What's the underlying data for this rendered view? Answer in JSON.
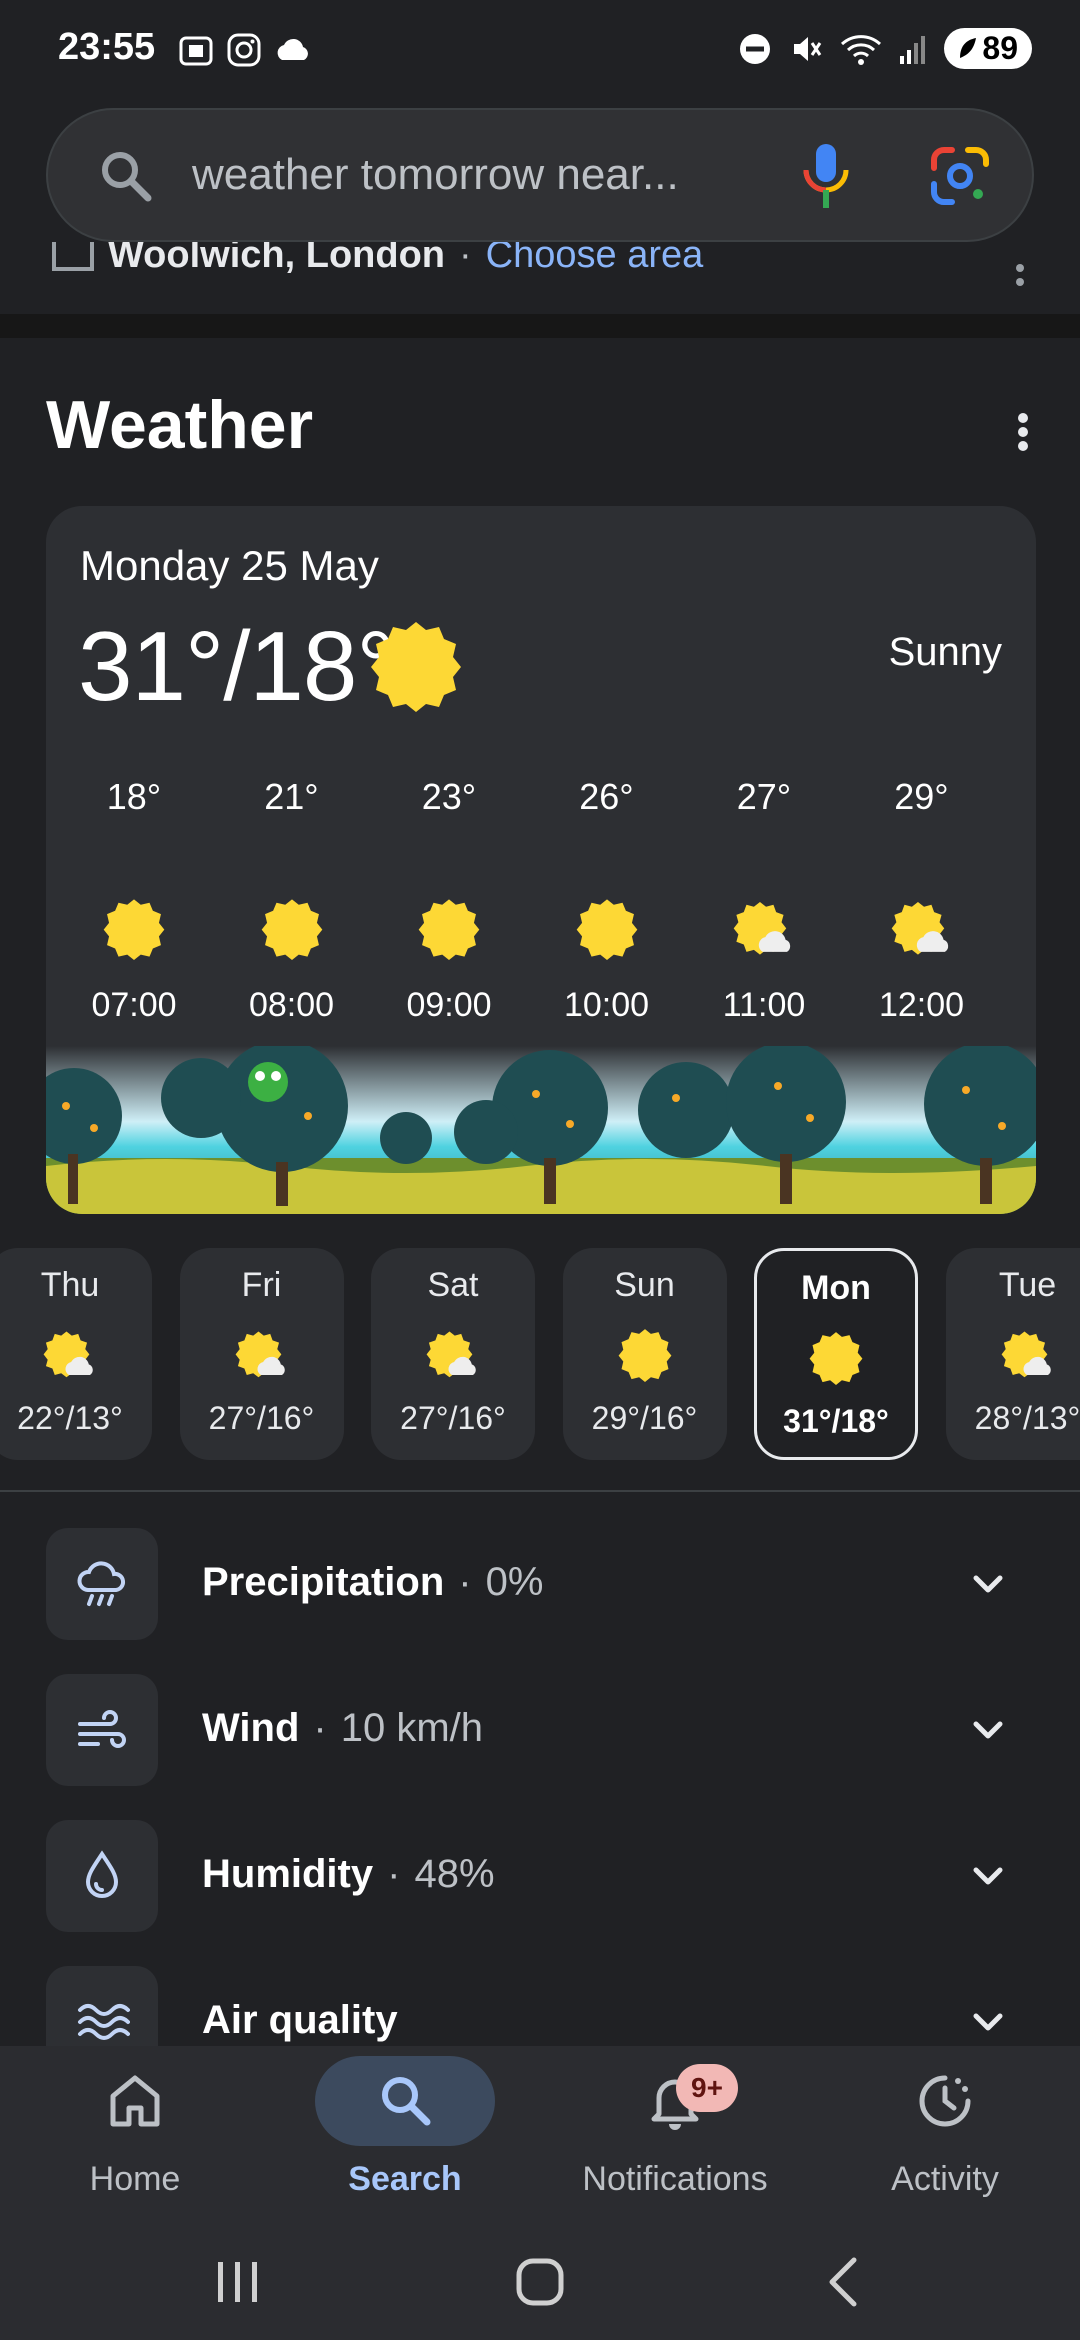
{
  "status_bar": {
    "time": "23:55",
    "battery": "89",
    "left_icons": [
      "screenshot-icon",
      "instagram-icon",
      "weather-cloud-icon"
    ],
    "right_icons": [
      "dnd-icon",
      "mute-icon",
      "wifi-icon",
      "signal-icon",
      "battery-icon"
    ]
  },
  "search": {
    "query": "weather tomorrow near..."
  },
  "location": {
    "name": "Woolwich, London",
    "separator": "·",
    "link": "Choose area"
  },
  "weather": {
    "title": "Weather",
    "date": "Monday 25 May",
    "temp": "31°/18°",
    "condition": "Sunny",
    "hourly": [
      {
        "temp": "18°",
        "time": "07:00",
        "icon": "sun"
      },
      {
        "temp": "21°",
        "time": "08:00",
        "icon": "sun"
      },
      {
        "temp": "23°",
        "time": "09:00",
        "icon": "sun"
      },
      {
        "temp": "26°",
        "time": "10:00",
        "icon": "sun"
      },
      {
        "temp": "27°",
        "time": "11:00",
        "icon": "sun-cloud"
      },
      {
        "temp": "29°",
        "time": "12:00",
        "icon": "sun-cloud"
      }
    ],
    "daily": [
      {
        "day": "Thu",
        "range": "22°/13°",
        "icon": "sun-cloud",
        "selected": false
      },
      {
        "day": "Fri",
        "range": "27°/16°",
        "icon": "sun-cloud",
        "selected": false
      },
      {
        "day": "Sat",
        "range": "27°/16°",
        "icon": "sun-cloud",
        "selected": false
      },
      {
        "day": "Sun",
        "range": "29°/16°",
        "icon": "sun",
        "selected": false
      },
      {
        "day": "Mon",
        "range": "31°/18°",
        "icon": "sun",
        "selected": true
      },
      {
        "day": "Tue",
        "range": "28°/13°",
        "icon": "sun-cloud",
        "selected": false
      }
    ],
    "details": [
      {
        "label": "Precipitation",
        "value": "0%",
        "icon": "rain-cloud-icon"
      },
      {
        "label": "Wind",
        "value": "10 km/h",
        "icon": "wind-icon"
      },
      {
        "label": "Humidity",
        "value": "48%",
        "icon": "droplet-icon"
      },
      {
        "label": "Air quality",
        "value": "",
        "icon": "air-waves-icon"
      }
    ]
  },
  "bottom_nav": {
    "items": [
      {
        "label": "Home",
        "icon": "home-icon"
      },
      {
        "label": "Search",
        "icon": "search-icon",
        "active": true
      },
      {
        "label": "Notifications",
        "icon": "bell-icon",
        "badge": "9+"
      },
      {
        "label": "Activity",
        "icon": "activity-icon"
      }
    ]
  },
  "colors": {
    "background": "#202124",
    "card": "#2d2f33",
    "accent_link": "#8ab4f8",
    "active_nav": "#a8c7fa",
    "sun": "#fdd835",
    "badge": "#f2b8b5"
  }
}
